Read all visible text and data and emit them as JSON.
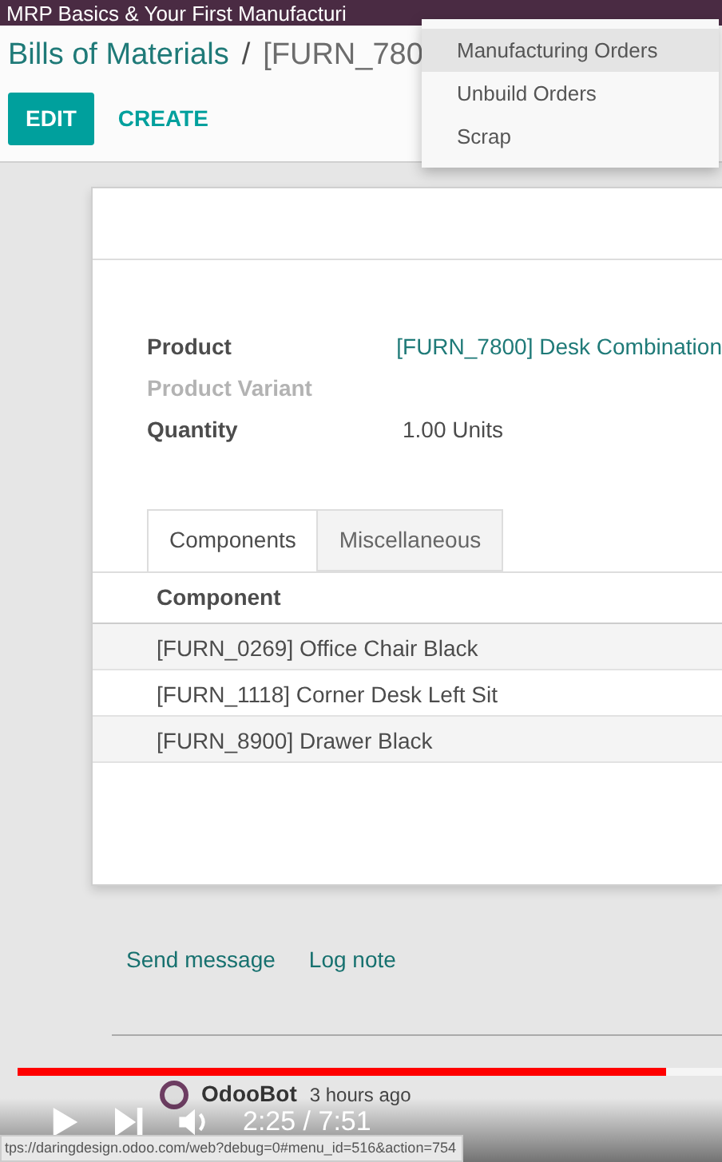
{
  "video_title": "MRP Basics & Your First Manufacturi",
  "breadcrumb": {
    "parent": "Bills of Materials",
    "separator": "/",
    "current": "[FURN_780"
  },
  "buttons": [
    {
      "label": "EDIT",
      "kind": "primary"
    },
    {
      "label": "CREATE",
      "kind": "link"
    }
  ],
  "dropdown": [
    {
      "label": "Manufacturing Orders",
      "selected": true
    },
    {
      "label": "Unbuild Orders",
      "selected": false
    },
    {
      "label": "Scrap",
      "selected": false
    }
  ],
  "fields": [
    {
      "label": "Product",
      "value": "[FURN_7800] Desk Combination",
      "kind": "link",
      "disabled": false
    },
    {
      "label": "Product Variant",
      "disabled": true
    },
    {
      "label": "Quantity",
      "value": "1.00 Units",
      "kind": "text",
      "disabled": false
    }
  ],
  "tabs": [
    {
      "label": "Components",
      "selected": true
    },
    {
      "label": "Miscellaneous",
      "selected": false
    }
  ],
  "table": {
    "columns": [
      "Component"
    ],
    "rows": [
      [
        "[FURN_0269] Office Chair Black"
      ],
      [
        "[FURN_1118] Corner Desk Left Sit"
      ],
      [
        "[FURN_8900] Drawer Black"
      ]
    ]
  },
  "chatter": {
    "actions": [
      "Send message",
      "Log note"
    ],
    "message": {
      "author": "OdooBot",
      "time": "3 hours ago"
    }
  },
  "player": {
    "level": 0.92,
    "time": "2:25 / 7:51"
  },
  "status_url": "tps://daringdesign.odoo.com/web?debug=0#menu_id=516&action=754"
}
